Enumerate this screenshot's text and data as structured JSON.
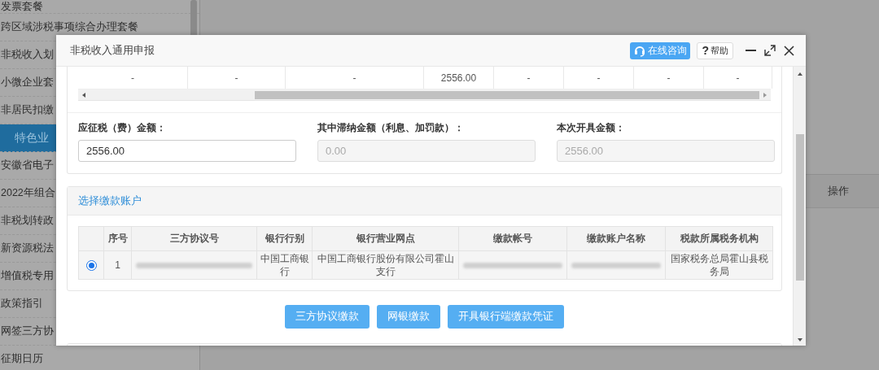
{
  "sidebar": {
    "items": [
      {
        "label": "发票套餐",
        "selected": false
      },
      {
        "label": "跨区域涉税事项综合办理套餐",
        "selected": false
      },
      {
        "label": "非税收入划",
        "selected": false
      },
      {
        "label": "小微企业套",
        "selected": false
      },
      {
        "label": "非居民扣缴",
        "selected": false
      },
      {
        "label": "特色业",
        "selected": true
      },
      {
        "label": "安徽省电子",
        "selected": false
      },
      {
        "label": "2022年组合",
        "selected": false
      },
      {
        "label": "非税划转政",
        "selected": false
      },
      {
        "label": "新资源税法",
        "selected": false
      },
      {
        "label": "增值税专用",
        "selected": false
      },
      {
        "label": "政策指引",
        "selected": false
      },
      {
        "label": "网签三方协",
        "selected": false
      },
      {
        "label": "征期日历",
        "selected": false
      }
    ]
  },
  "main_table": {
    "columns": [
      "操作"
    ]
  },
  "dialog": {
    "title": "非税收入通用申报",
    "consult_button": "在线咨询",
    "help_mark": "?",
    "help_button": "帮助",
    "detail_row": [
      "-",
      "-",
      "-",
      "2556.00",
      "-",
      "-",
      "-",
      "-"
    ],
    "fields": [
      {
        "label": "应征税（费）金额：",
        "value": "2556.00",
        "disabled": false
      },
      {
        "label": "其中滞纳金额（利息、加罚款）：",
        "value": "0.00",
        "disabled": true
      },
      {
        "label": "本次开具金额：",
        "value": "2556.00",
        "disabled": true
      }
    ],
    "account_panel": {
      "title": "选择缴款账户",
      "columns": [
        "序号",
        "三方协议号",
        "银行行别",
        "银行营业网点",
        "缴款帐号",
        "缴款账户名称",
        "税款所属税务机构"
      ],
      "rows": [
        {
          "selected": true,
          "cells": [
            {
              "kind": "text",
              "text": "1"
            },
            {
              "kind": "redacted"
            },
            {
              "kind": "text",
              "text": "中国工商银行"
            },
            {
              "kind": "text",
              "text": "中国工商银行股份有限公司霍山支行"
            },
            {
              "kind": "redacted"
            },
            {
              "kind": "redacted"
            },
            {
              "kind": "text",
              "text": "国家税务总局霍山县税务局"
            }
          ]
        }
      ]
    },
    "actions": [
      "三方协议缴款",
      "网银缴款",
      "开具银行端缴款凭证"
    ]
  }
}
